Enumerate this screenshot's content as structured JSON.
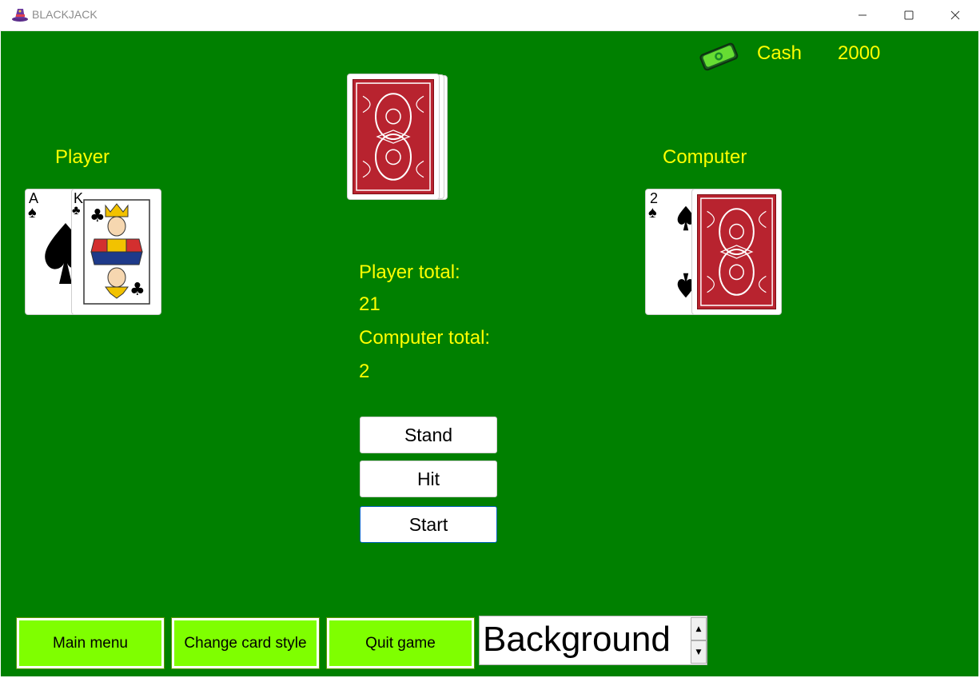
{
  "window": {
    "title": "BLACKJACK",
    "minimize_label": "—",
    "maximize_label": "☐",
    "close_label": "✕",
    "app_icon": "wizard-hat-icon"
  },
  "header": {
    "cash_label": "Cash",
    "cash_value": "2000",
    "cash_icon": "money-bill-icon"
  },
  "player": {
    "label": "Player",
    "cards": [
      {
        "rank": "A",
        "suit": "♠",
        "face_up": true
      },
      {
        "rank": "K",
        "suit": "♣",
        "face_up": true
      }
    ]
  },
  "computer": {
    "label": "Computer",
    "cards": [
      {
        "rank": "2",
        "suit": "♠",
        "face_up": true
      },
      {
        "face_up": false
      }
    ]
  },
  "totals": {
    "player_label": "Player total:",
    "player_value": "21",
    "computer_label": "Computer total:",
    "computer_value": "2"
  },
  "actions": {
    "stand": "Stand",
    "hit": "Hit",
    "start": "Start"
  },
  "bottom_bar": {
    "main_menu": "Main menu",
    "change_card_style": "Change card style",
    "quit_game": "Quit game",
    "background_selector": "Background"
  },
  "colors": {
    "table_green": "#008000",
    "label_yellow": "#ffff00",
    "button_green": "#7fff00",
    "card_back_red": "#b8232f"
  }
}
